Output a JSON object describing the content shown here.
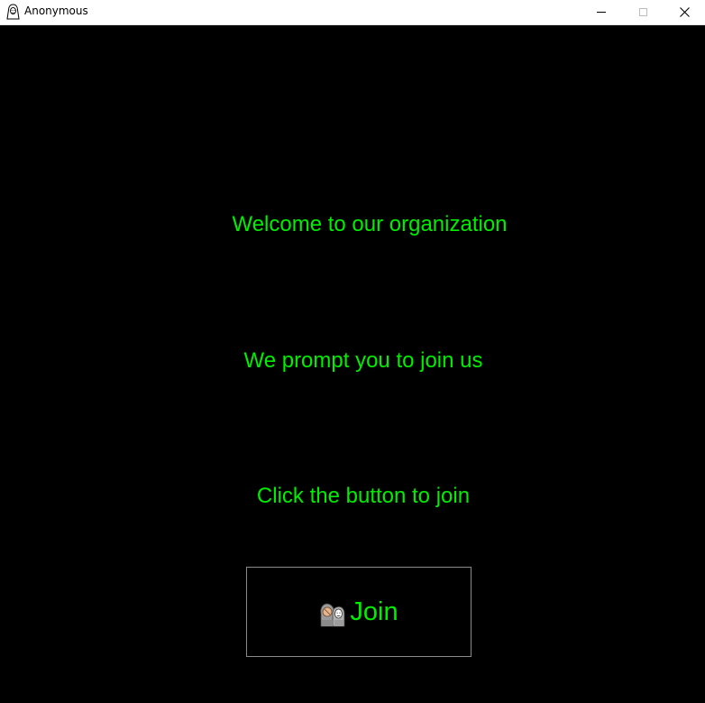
{
  "window": {
    "title": "Anonymous",
    "controls": {
      "minimize": "minimize-icon",
      "maximize": "maximize-icon",
      "close": "close-icon"
    }
  },
  "messages": {
    "welcome": "Welcome to our organization",
    "prompt": "We prompt you to join us",
    "instruction": "Click the button to join"
  },
  "join_button": {
    "label": "Join",
    "icon": "anonymous-mask-icon"
  },
  "colors": {
    "background": "#000000",
    "text": "#00ee00",
    "button_border": "#8a8a8a"
  }
}
